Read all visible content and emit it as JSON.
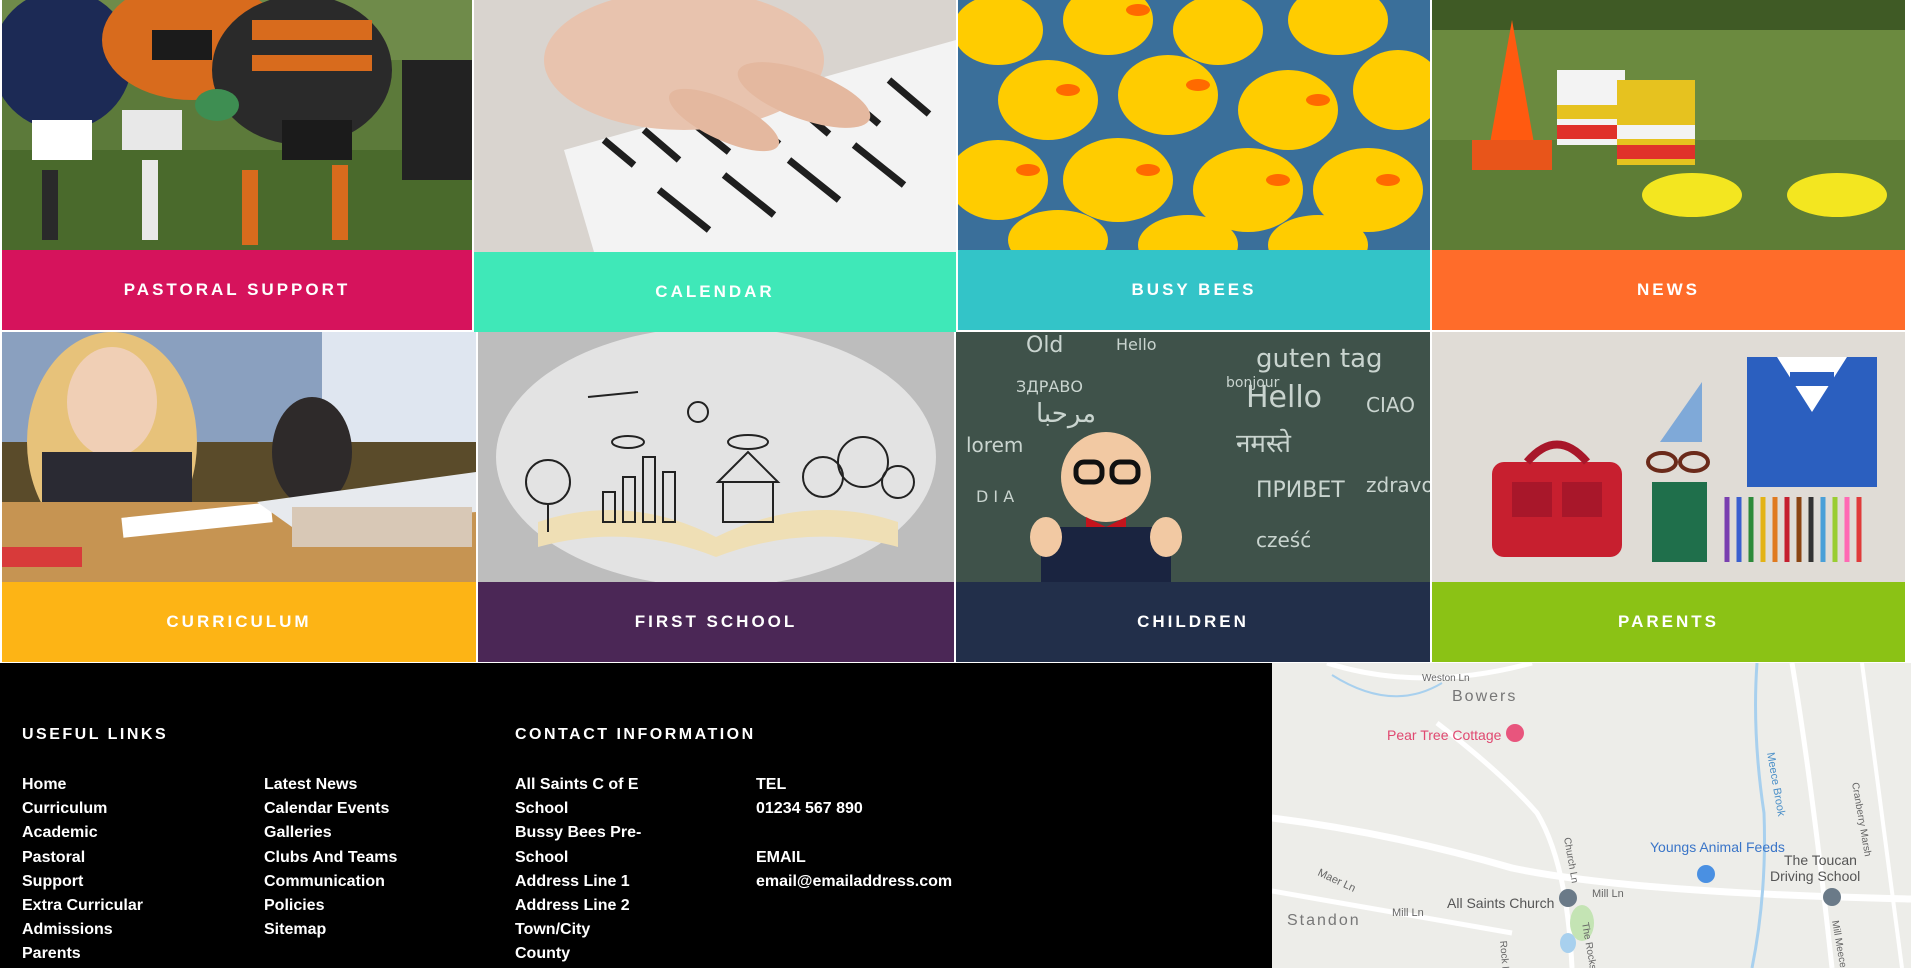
{
  "tiles": [
    {
      "label": "PASTORAL SUPPORT",
      "color": "#d6135c",
      "photo": "rugby-players"
    },
    {
      "label": "CALENDAR",
      "color": "#3fe8b8",
      "photo": "piano-hands"
    },
    {
      "label": "BUSY BEES",
      "color": "#33c4c8",
      "photo": "rubber-ducks"
    },
    {
      "label": "NEWS",
      "color": "#ff6c2a",
      "photo": "sports-cones"
    },
    {
      "label": "CURRICULUM",
      "color": "#fdb415",
      "photo": "girl-reading"
    },
    {
      "label": "FIRST SCHOOL",
      "color": "#4b2756",
      "photo": "open-book-drawing"
    },
    {
      "label": "CHILDREN",
      "color": "#222f4a",
      "photo": "boy-chalkboard"
    },
    {
      "label": "PARENTS",
      "color": "#8bc215",
      "photo": "school-uniform"
    }
  ],
  "footer": {
    "useful_links_title": "USEFUL LINKS",
    "useful_links_col1": [
      "Home",
      "Curriculum",
      "Academic",
      "Pastoral",
      "Support",
      "Extra Curricular",
      "Admissions",
      "Parents"
    ],
    "useful_links_col2": [
      "Latest News",
      "Calendar Events",
      "Galleries",
      "Clubs And Teams",
      "Communication",
      "Policies",
      "Sitemap"
    ],
    "contact_title": "CONTACT INFORMATION",
    "address": [
      "All Saints C of E",
      "School",
      "Bussy Bees Pre-",
      "School",
      "Address Line 1",
      "Address Line 2",
      "Town/City",
      "County"
    ],
    "tel_label": "TEL",
    "tel": "01234 567 890",
    "email_label": "EMAIL",
    "email": "email@emailaddress.com"
  },
  "map": {
    "places": [
      "Bowers",
      "Pear Tree Cottage",
      "Youngs Animal Feeds",
      "The Toucan",
      "Driving School",
      "All Saints Church",
      "Standon"
    ],
    "roads": [
      "Weston Ln",
      "Meece Brook",
      "Cranberry Marsh",
      "Church Ln",
      "Maer Ln",
      "Mill Ln",
      "Mill Ln",
      "Rock Ln",
      "The Rocks",
      "Mill Meece"
    ]
  }
}
